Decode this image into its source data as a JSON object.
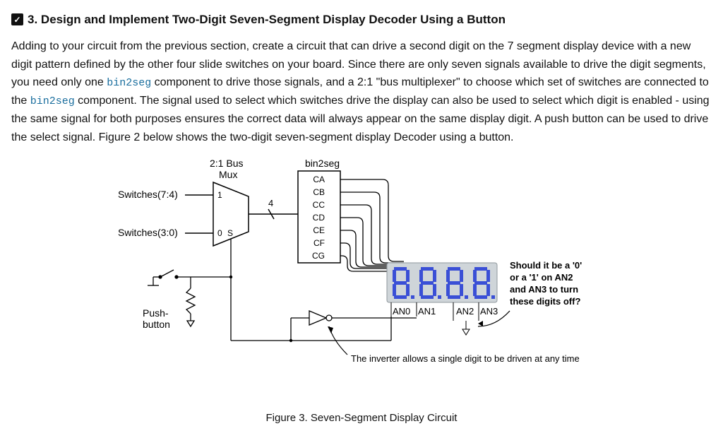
{
  "heading": {
    "number": "3.",
    "title": "Design and Implement Two-Digit Seven-Segment Display Decoder Using a Button"
  },
  "body": {
    "p1a": "Adding to your circuit from the previous section, create a circuit that can drive a second digit on the 7 segment display device with a new digit pattern defined by the other four slide switches on your board. Since there are only seven signals available to drive the digit segments, you need only one ",
    "code1": "bin2seg",
    "p1b": " component to drive those signals, and a 2:1 \"bus multiplexer\" to choose which set of switches are connected to the ",
    "code2": "bin2seg",
    "p1c": " component. The signal used to select which switches drive the display can also be used to select which digit is enabled - using the same signal for both purposes ensures the correct data will always appear on the same display digit. A push button can be used to drive the select signal. Figure 2 below shows the two-digit seven-segment display Decoder using a button."
  },
  "diagram": {
    "mux_label_line1": "2:1 Bus",
    "mux_label_line2": "Mux",
    "switches_hi": "Switches(7:4)",
    "switches_lo": "Switches(3:0)",
    "mux_in_hi": "1",
    "mux_in_lo": "0",
    "mux_sel": "S",
    "bus_width": "4",
    "bin2seg_label": "bin2seg",
    "seg_ca": "CA",
    "seg_cb": "CB",
    "seg_cc": "CC",
    "seg_cd": "CD",
    "seg_ce": "CE",
    "seg_cf": "CF",
    "seg_cg": "CG",
    "pushbutton_line1": "Push-",
    "pushbutton_line2": "button",
    "an0": "AN0",
    "an1": "AN1",
    "an2": "AN2",
    "an3": "AN3",
    "note_line1": "Should it be a '0'",
    "note_line2": "or a '1' on AN2",
    "note_line3": "and AN3 to turn",
    "note_line4": "these digits off?",
    "inverter_note": "The inverter allows a single digit to be driven at any time",
    "caption": "Figure 3. Seven-Segment Display Circuit"
  }
}
